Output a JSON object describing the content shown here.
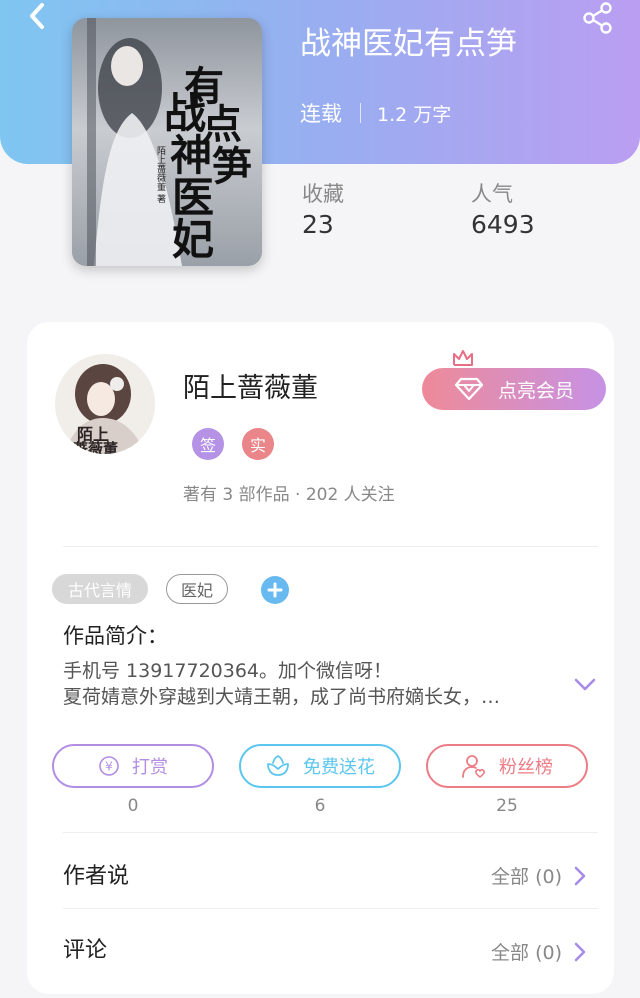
{
  "header": {
    "title": "战神医妃有点笋",
    "status": "连载",
    "word_count": "1.2 万字",
    "stats": [
      {
        "label": "收藏",
        "value": "23"
      },
      {
        "label": "人气",
        "value": "6493"
      }
    ],
    "cover": {
      "title_text": "战神医妃有点笋",
      "author_text": "陌上蔷薇董 著"
    }
  },
  "author": {
    "name": "陌上蔷薇董",
    "avatar_text": "陌上蔷薇董",
    "badges": [
      "签",
      "实"
    ],
    "works_info": "著有 3 部作品 · 202 人关注",
    "vip_button": "点亮会员"
  },
  "tags": [
    "古代言情",
    "医妃"
  ],
  "synopsis": {
    "label": "作品简介：",
    "lines": [
      "手机号 13917720364。加个微信呀！",
      "夏荷婧意外穿越到大靖王朝，成了尚书府嫡长女，…"
    ]
  },
  "actions": [
    {
      "label": "打赏",
      "count": "0",
      "icon": "yen-coin-icon",
      "color": "#b28ee3"
    },
    {
      "label": "免费送花",
      "count": "6",
      "icon": "flower-icon",
      "color": "#5cc6ee"
    },
    {
      "label": "粉丝榜",
      "count": "25",
      "icon": "fan-person-icon",
      "color": "#ec7c86"
    }
  ],
  "rows": [
    {
      "label": "作者说",
      "value": "全部 (0)"
    },
    {
      "label": "评论",
      "value": "全部 (0)"
    }
  ],
  "colors": {
    "header_gradient": [
      "#7fc6f1",
      "#ba9ef1"
    ],
    "badge_sign": "#b592e6",
    "badge_real": "#ea8589",
    "chevron": "#a78be6"
  }
}
